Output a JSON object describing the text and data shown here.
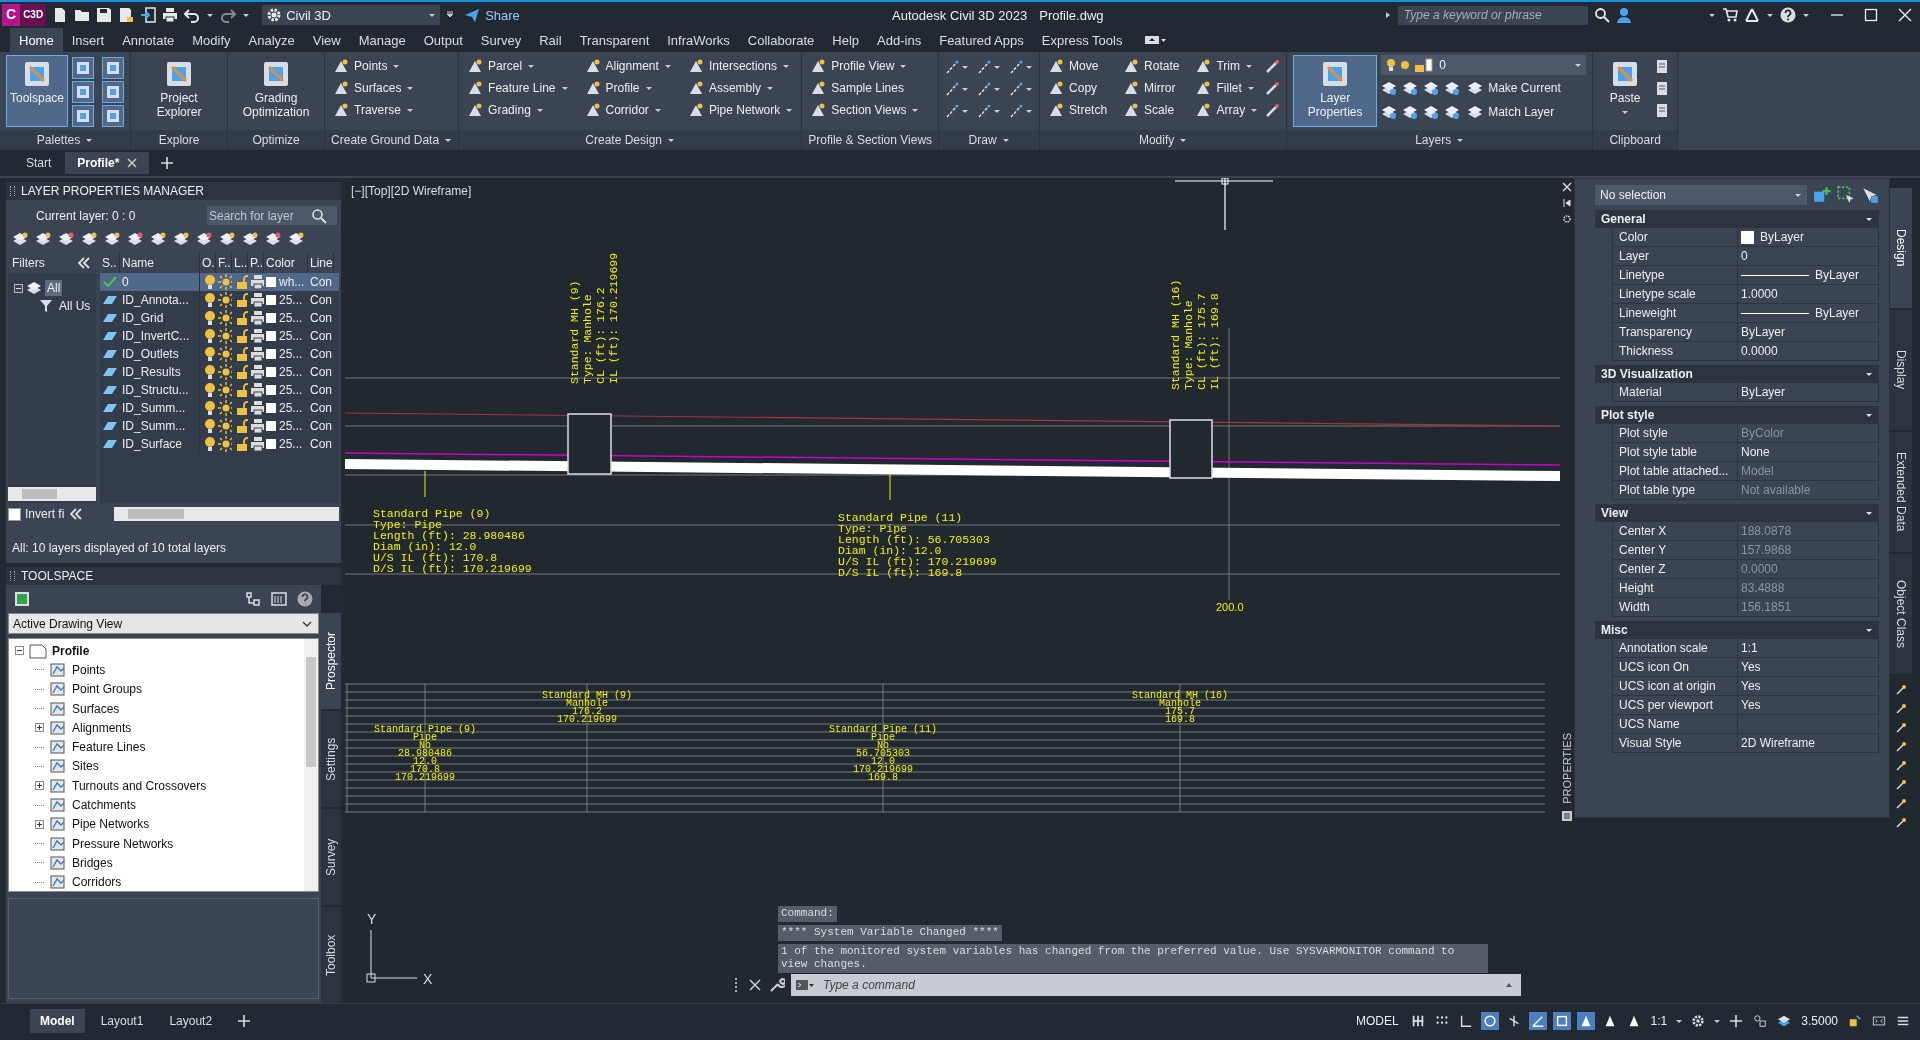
{
  "app": {
    "logo_letter": "C",
    "logo_badge": "C3D",
    "workspace": "Civil 3D",
    "share": "Share",
    "title": "Autodesk Civil 3D 2023",
    "file": "Profile.dwg",
    "search_placeholder": "Type a keyword or phrase"
  },
  "menu_tabs": [
    {
      "label": "Home",
      "selected": true
    },
    {
      "label": "Insert",
      "selected": false
    },
    {
      "label": "Annotate",
      "selected": false
    },
    {
      "label": "Modify",
      "selected": false
    },
    {
      "label": "Analyze",
      "selected": false
    },
    {
      "label": "View",
      "selected": false
    },
    {
      "label": "Manage",
      "selected": false
    },
    {
      "label": "Output",
      "selected": false
    },
    {
      "label": "Survey",
      "selected": false
    },
    {
      "label": "Rail",
      "selected": false
    },
    {
      "label": "Transparent",
      "selected": false
    },
    {
      "label": "InfraWorks",
      "selected": false
    },
    {
      "label": "Collaborate",
      "selected": false
    },
    {
      "label": "Help",
      "selected": false
    },
    {
      "label": "Add-ins",
      "selected": false
    },
    {
      "label": "Featured Apps",
      "selected": false
    },
    {
      "label": "Express Tools",
      "selected": false
    }
  ],
  "ribbon_panels": [
    {
      "kind": "palettes",
      "title": "Palettes",
      "menu": true,
      "large": [
        {
          "label": "Toolspace",
          "selected": true,
          "dropdown": false
        }
      ]
    },
    {
      "kind": "large",
      "title": "Explore",
      "menu": false,
      "large": [
        {
          "label": "Project Explorer",
          "selected": false,
          "dropdown": false
        }
      ]
    },
    {
      "kind": "large",
      "title": "Optimize",
      "menu": false,
      "large": [
        {
          "label": "Grading Optimization",
          "selected": false,
          "dropdown": false
        }
      ]
    },
    {
      "kind": "tools",
      "title": "Create Ground Data",
      "menu": true,
      "tools": [
        {
          "label": "Points",
          "dropdown": true
        },
        {
          "label": "Surfaces",
          "dropdown": true
        },
        {
          "label": "Traverse",
          "dropdown": true
        }
      ]
    },
    {
      "kind": "tools",
      "title": "Create Design",
      "menu": true,
      "tools": [
        {
          "label": "Parcel",
          "dropdown": true
        },
        {
          "label": "Feature Line",
          "dropdown": true
        },
        {
          "label": "Grading",
          "dropdown": true
        },
        {
          "label": "Alignment",
          "dropdown": true
        },
        {
          "label": "Profile",
          "dropdown": true
        },
        {
          "label": "Corridor",
          "dropdown": true
        },
        {
          "label": "Intersections",
          "dropdown": true
        },
        {
          "label": "Assembly",
          "dropdown": true
        },
        {
          "label": "Pipe Network",
          "dropdown": true
        }
      ]
    },
    {
      "kind": "tools",
      "title": "Profile & Section Views",
      "menu": false,
      "tools": [
        {
          "label": "Profile View",
          "dropdown": true
        },
        {
          "label": "Sample Lines",
          "dropdown": false
        },
        {
          "label": "Section Views",
          "dropdown": true
        }
      ]
    },
    {
      "kind": "draw",
      "title": "Draw",
      "menu": true
    },
    {
      "kind": "modify",
      "title": "Modify",
      "menu": true,
      "tools": [
        {
          "label": "Move",
          "dropdown": false
        },
        {
          "label": "Copy",
          "dropdown": false
        },
        {
          "label": "Stretch",
          "dropdown": false
        },
        {
          "label": "Rotate",
          "dropdown": false
        },
        {
          "label": "Mirror",
          "dropdown": false
        },
        {
          "label": "Scale",
          "dropdown": false
        },
        {
          "label": "Trim",
          "dropdown": true
        },
        {
          "label": "Fillet",
          "dropdown": true
        },
        {
          "label": "Array",
          "dropdown": true
        }
      ]
    },
    {
      "kind": "layers",
      "title": "Layers",
      "menu": true,
      "large": [
        {
          "label": "Layer Properties",
          "selected": true,
          "dropdown": false
        }
      ],
      "layer": "0",
      "tools": [
        {
          "label": "Make Current",
          "dropdown": false
        },
        {
          "label": "Match Layer",
          "dropdown": false
        }
      ]
    },
    {
      "kind": "clipboard",
      "title": "Clipboard",
      "menu": false,
      "large": [
        {
          "label": "Paste",
          "selected": false,
          "dropdown": true
        }
      ]
    }
  ],
  "doc_tabs": [
    {
      "label": "Start",
      "selected": false,
      "closable": false
    },
    {
      "label": "Profile*",
      "selected": true,
      "closable": true
    }
  ],
  "layer_manager": {
    "title": "LAYER PROPERTIES MANAGER",
    "current_layer": "Current layer: 0 : 0",
    "search_placeholder": "Search for layer",
    "filters_label": "Filters",
    "filters": [
      {
        "label": "All",
        "selected": true,
        "children": [
          {
            "label": "All Us",
            "selected": false
          }
        ]
      }
    ],
    "invert_filter": {
      "label": "Invert fi",
      "checked": false
    },
    "columns": [
      "S..",
      "Name",
      "O.",
      "F..",
      "L..",
      "P..",
      "Color",
      "Line"
    ],
    "layers": [
      {
        "name": "0",
        "color_name": "wh...",
        "linetype": "Con",
        "current": true,
        "selected": true
      },
      {
        "name": "ID_Annota...",
        "color_name": "25...",
        "linetype": "Con",
        "current": false,
        "selected": false
      },
      {
        "name": "ID_Grid",
        "color_name": "25...",
        "linetype": "Con",
        "current": false,
        "selected": false
      },
      {
        "name": "ID_InvertC...",
        "color_name": "25...",
        "linetype": "Con",
        "current": false,
        "selected": false
      },
      {
        "name": "ID_Outlets",
        "color_name": "25...",
        "linetype": "Con",
        "current": false,
        "selected": false
      },
      {
        "name": "ID_Results",
        "color_name": "25...",
        "linetype": "Con",
        "current": false,
        "selected": false
      },
      {
        "name": "ID_Structu...",
        "color_name": "25...",
        "linetype": "Con",
        "current": false,
        "selected": false
      },
      {
        "name": "ID_Summ...",
        "color_name": "25...",
        "linetype": "Con",
        "current": false,
        "selected": false
      },
      {
        "name": "ID_Summ...",
        "color_name": "25...",
        "linetype": "Con",
        "current": false,
        "selected": false
      },
      {
        "name": "ID_Surface",
        "color_name": "25...",
        "linetype": "Con",
        "current": false,
        "selected": false
      }
    ],
    "footer": "All: 10 layers displayed of 10 total layers"
  },
  "toolspace": {
    "title": "TOOLSPACE",
    "view": "Active Drawing View",
    "tree": {
      "label": "Profile",
      "expanded": true,
      "children": [
        {
          "label": "Points",
          "expandable": false
        },
        {
          "label": "Point Groups",
          "expandable": false
        },
        {
          "label": "Surfaces",
          "expandable": false
        },
        {
          "label": "Alignments",
          "expandable": true
        },
        {
          "label": "Feature Lines",
          "expandable": false
        },
        {
          "label": "Sites",
          "expandable": false
        },
        {
          "label": "Turnouts and Crossovers",
          "expandable": true
        },
        {
          "label": "Catchments",
          "expandable": false
        },
        {
          "label": "Pipe Networks",
          "expandable": true
        },
        {
          "label": "Pressure Networks",
          "expandable": false
        },
        {
          "label": "Bridges",
          "expandable": false
        },
        {
          "label": "Corridors",
          "expandable": false
        }
      ]
    },
    "side_tabs": [
      {
        "label": "Prospector",
        "selected": true
      },
      {
        "label": "Settings",
        "selected": false
      },
      {
        "label": "Survey",
        "selected": false
      },
      {
        "label": "Toolbox",
        "selected": false
      }
    ]
  },
  "drawing": {
    "viewport_label": "[−][Top][2D Wireframe]",
    "structure_labels": [
      {
        "lines": [
          "Standard MH (9)",
          "Type: Manhole",
          "CL (ft): 176.2",
          "IL (ft): 170.219699"
        ]
      },
      {
        "lines": [
          "Standard MH (16)",
          "Type: Manhole",
          "CL (ft): 175.7",
          "IL (ft): 169.8"
        ]
      }
    ],
    "pipe_labels": [
      {
        "lines": [
          "Standard Pipe (9)",
          "Type: Pipe",
          "Length (ft): 28.980486",
          "Diam (in): 12.0",
          "U/S IL (ft): 170.8",
          "D/S IL (ft): 170.219699"
        ]
      },
      {
        "lines": [
          "Standard Pipe (11)",
          "Type: Pipe",
          "Length (ft): 56.705303",
          "Diam (in): 12.0",
          "U/S IL (ft): 170.219699",
          "D/S IL (ft): 169.8"
        ]
      }
    ],
    "station_label": "200.0",
    "band_structures": [
      {
        "lines": [
          "Standard MH (9)",
          "Manhole",
          "176.2",
          "170.219699"
        ]
      },
      {
        "lines": [
          "Standard MH (16)",
          "Manhole",
          "175.7",
          "169.8"
        ]
      }
    ],
    "band_pipes": [
      {
        "lines": [
          "Standard Pipe (9)",
          "Pipe",
          "No",
          "28.980486",
          "12.0",
          "170.8",
          "170.219699"
        ]
      },
      {
        "lines": [
          "Standard Pipe (11)",
          "Pipe",
          "No",
          "56.705303",
          "12.0",
          "170.219699",
          "169.8"
        ]
      }
    ],
    "ucs": {
      "x": "X",
      "y": "Y"
    }
  },
  "command": {
    "history": [
      "Command:",
      "**** System Variable Changed ****",
      "1 of the monitored system variables has changed from the preferred value. Use SYSVARMONITOR command to view changes."
    ],
    "placeholder": "Type a command"
  },
  "properties": {
    "palette_label": "PROPERTIES",
    "selection": "No selection",
    "sections": [
      {
        "title": "General",
        "expanded": true,
        "rows": [
          {
            "label": "Color",
            "value": "ByLayer",
            "kind": "swatch",
            "disabled": false
          },
          {
            "label": "Layer",
            "value": "0",
            "kind": "text",
            "disabled": false
          },
          {
            "label": "Linetype",
            "value": "ByLayer",
            "kind": "line",
            "disabled": false
          },
          {
            "label": "Linetype scale",
            "value": "1.0000",
            "kind": "text",
            "disabled": false
          },
          {
            "label": "Lineweight",
            "value": "ByLayer",
            "kind": "line",
            "disabled": false
          },
          {
            "label": "Transparency",
            "value": "ByLayer",
            "kind": "text",
            "disabled": false
          },
          {
            "label": "Thickness",
            "value": "0.0000",
            "kind": "text",
            "disabled": false
          }
        ]
      },
      {
        "title": "3D Visualization",
        "expanded": true,
        "rows": [
          {
            "label": "Material",
            "value": "ByLayer",
            "kind": "text",
            "disabled": false
          }
        ]
      },
      {
        "title": "Plot style",
        "expanded": true,
        "rows": [
          {
            "label": "Plot style",
            "value": "ByColor",
            "kind": "text",
            "disabled": true
          },
          {
            "label": "Plot style table",
            "value": "None",
            "kind": "text",
            "disabled": false
          },
          {
            "label": "Plot table attached...",
            "value": "Model",
            "kind": "text",
            "disabled": true
          },
          {
            "label": "Plot table type",
            "value": "Not available",
            "kind": "text",
            "disabled": true
          }
        ]
      },
      {
        "title": "View",
        "expanded": true,
        "rows": [
          {
            "label": "Center X",
            "value": "188.0878",
            "kind": "text",
            "disabled": true
          },
          {
            "label": "Center Y",
            "value": "157.9868",
            "kind": "text",
            "disabled": true
          },
          {
            "label": "Center Z",
            "value": "0.0000",
            "kind": "text",
            "disabled": true
          },
          {
            "label": "Height",
            "value": "83.4888",
            "kind": "text",
            "disabled": true
          },
          {
            "label": "Width",
            "value": "156.1851",
            "kind": "text",
            "disabled": true
          }
        ]
      },
      {
        "title": "Misc",
        "expanded": true,
        "rows": [
          {
            "label": "Annotation scale",
            "value": "1:1",
            "kind": "text",
            "disabled": false
          },
          {
            "label": "UCS icon On",
            "value": "Yes",
            "kind": "text",
            "disabled": false
          },
          {
            "label": "UCS icon at origin",
            "value": "Yes",
            "kind": "text",
            "disabled": false
          },
          {
            "label": "UCS per viewport",
            "value": "Yes",
            "kind": "text",
            "disabled": false
          },
          {
            "label": "UCS Name",
            "kind": "text",
            "disabled": false
          },
          {
            "label": "Visual Style",
            "value": "2D Wireframe",
            "kind": "text",
            "disabled": false
          }
        ]
      }
    ],
    "side_tabs": [
      {
        "label": "Design",
        "selected": true
      },
      {
        "label": "Display",
        "selected": false
      },
      {
        "label": "Extended Data",
        "selected": false
      },
      {
        "label": "Object Class",
        "selected": false
      }
    ]
  },
  "status_bar": {
    "layout_tabs": [
      {
        "label": "Model",
        "selected": true
      },
      {
        "label": "Layout1",
        "selected": false
      },
      {
        "label": "Layout2",
        "selected": false
      }
    ],
    "space": "MODEL",
    "toggles": [
      {
        "kind": "grid",
        "on": false
      },
      {
        "kind": "snap",
        "on": false
      },
      {
        "kind": "ortho",
        "on": false
      },
      {
        "kind": "polar",
        "on": true
      },
      {
        "kind": "iso",
        "on": false
      },
      {
        "kind": "angle",
        "on": true
      },
      {
        "kind": "frame",
        "on": true
      },
      {
        "kind": "annotate",
        "on": true
      },
      {
        "kind": "annotate",
        "on": false
      },
      {
        "kind": "annotate",
        "on": false
      }
    ],
    "scale": "1:1",
    "lineweight": "3.5000"
  }
}
